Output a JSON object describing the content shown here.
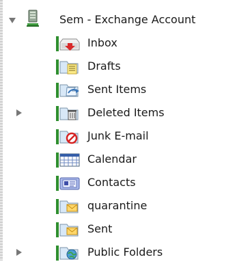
{
  "account": {
    "label": "Sem - Exchange Account",
    "expanded": true
  },
  "folders": [
    {
      "label": "Inbox",
      "icon": "inbox-icon"
    },
    {
      "label": "Drafts",
      "icon": "drafts-icon"
    },
    {
      "label": "Sent Items",
      "icon": "sent-items-icon"
    },
    {
      "label": "Deleted Items",
      "icon": "deleted-items-icon",
      "collapsed": true
    },
    {
      "label": "Junk E-mail",
      "icon": "junk-email-icon"
    },
    {
      "label": "Calendar",
      "icon": "calendar-icon"
    },
    {
      "label": "Contacts",
      "icon": "contacts-icon"
    },
    {
      "label": "quarantine",
      "icon": "quarantine-icon"
    },
    {
      "label": "Sent",
      "icon": "sent-icon"
    },
    {
      "label": "Public Folders",
      "icon": "public-folders-icon",
      "collapsed": true
    }
  ]
}
